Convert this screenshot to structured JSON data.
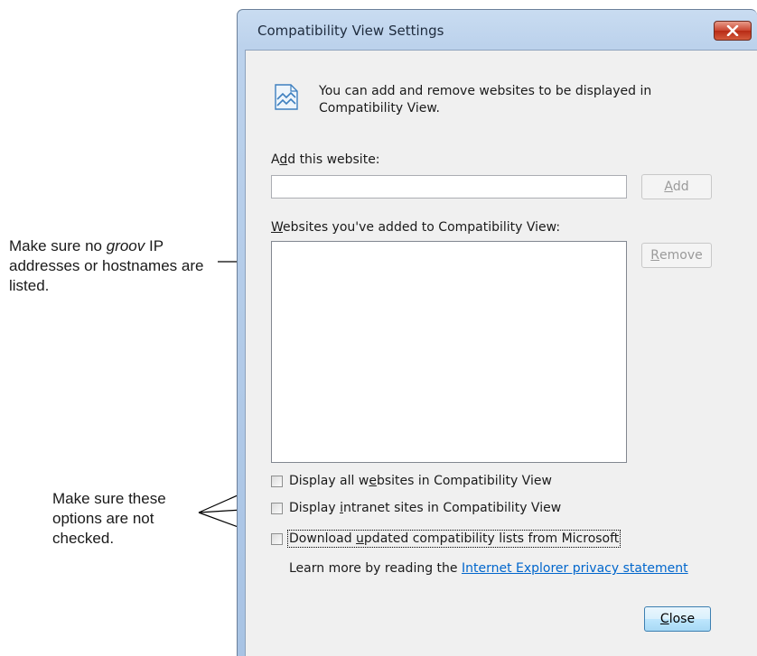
{
  "annotations": {
    "note_websites": {
      "before": "Make sure no ",
      "italic": "groov",
      "after": " IP addresses or hostnames are listed."
    },
    "note_options": "Make sure these options are not checked."
  },
  "dialog": {
    "title": "Compatibility View Settings",
    "info_text": "You can add and remove websites to be displayed in Compatibility View.",
    "add_label": {
      "pre": "A",
      "key": "d",
      "post": "d this website:"
    },
    "add_input_value": "",
    "add_button": {
      "key": "A",
      "post": "dd"
    },
    "list_label": {
      "key": "W",
      "post": "ebsites you've added to Compatibility View:"
    },
    "list_items": [],
    "remove_button": {
      "key": "R",
      "post": "emove"
    },
    "options": [
      {
        "pre": "Display all w",
        "key": "e",
        "post": "bsites in Compatibility View",
        "checked": false
      },
      {
        "pre": "Display ",
        "key": "i",
        "post": "ntranet sites in Compatibility View",
        "checked": false
      },
      {
        "pre": "Download ",
        "key": "u",
        "post": "pdated compatibility lists from Microsoft",
        "checked": false
      }
    ],
    "learn_more_text": "Learn more by reading the ",
    "learn_more_link": "Internet Explorer privacy statement",
    "close_button": {
      "key": "C",
      "post": "lose"
    }
  },
  "colors": {
    "link": "#0066cc",
    "title_close": "#c9452f"
  }
}
